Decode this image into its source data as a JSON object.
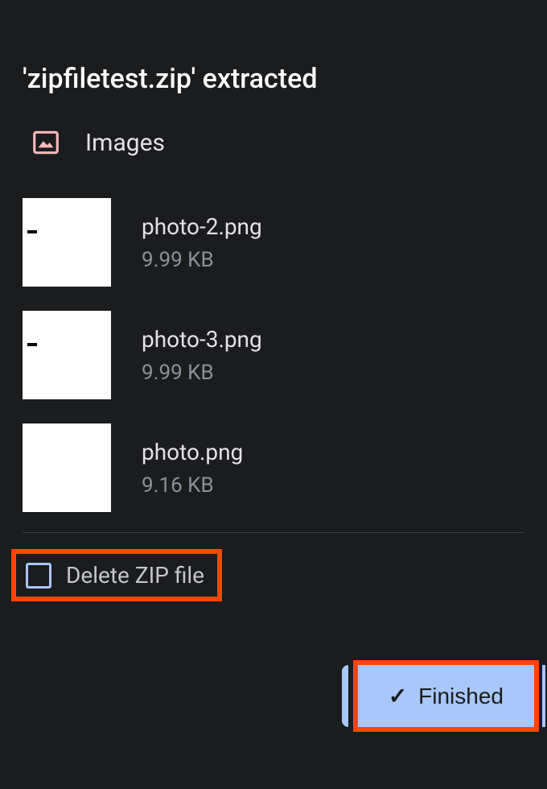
{
  "title": "'zipfiletest.zip' extracted",
  "section": {
    "label": "Images",
    "icon": "image-icon"
  },
  "files": [
    {
      "name": "photo-2.png",
      "size": "9.99 KB"
    },
    {
      "name": "photo-3.png",
      "size": "9.99 KB"
    },
    {
      "name": "photo.png",
      "size": "9.16 KB"
    }
  ],
  "deleteOption": {
    "label": "Delete ZIP file",
    "checked": false
  },
  "finishedButton": {
    "label": "Finished"
  }
}
